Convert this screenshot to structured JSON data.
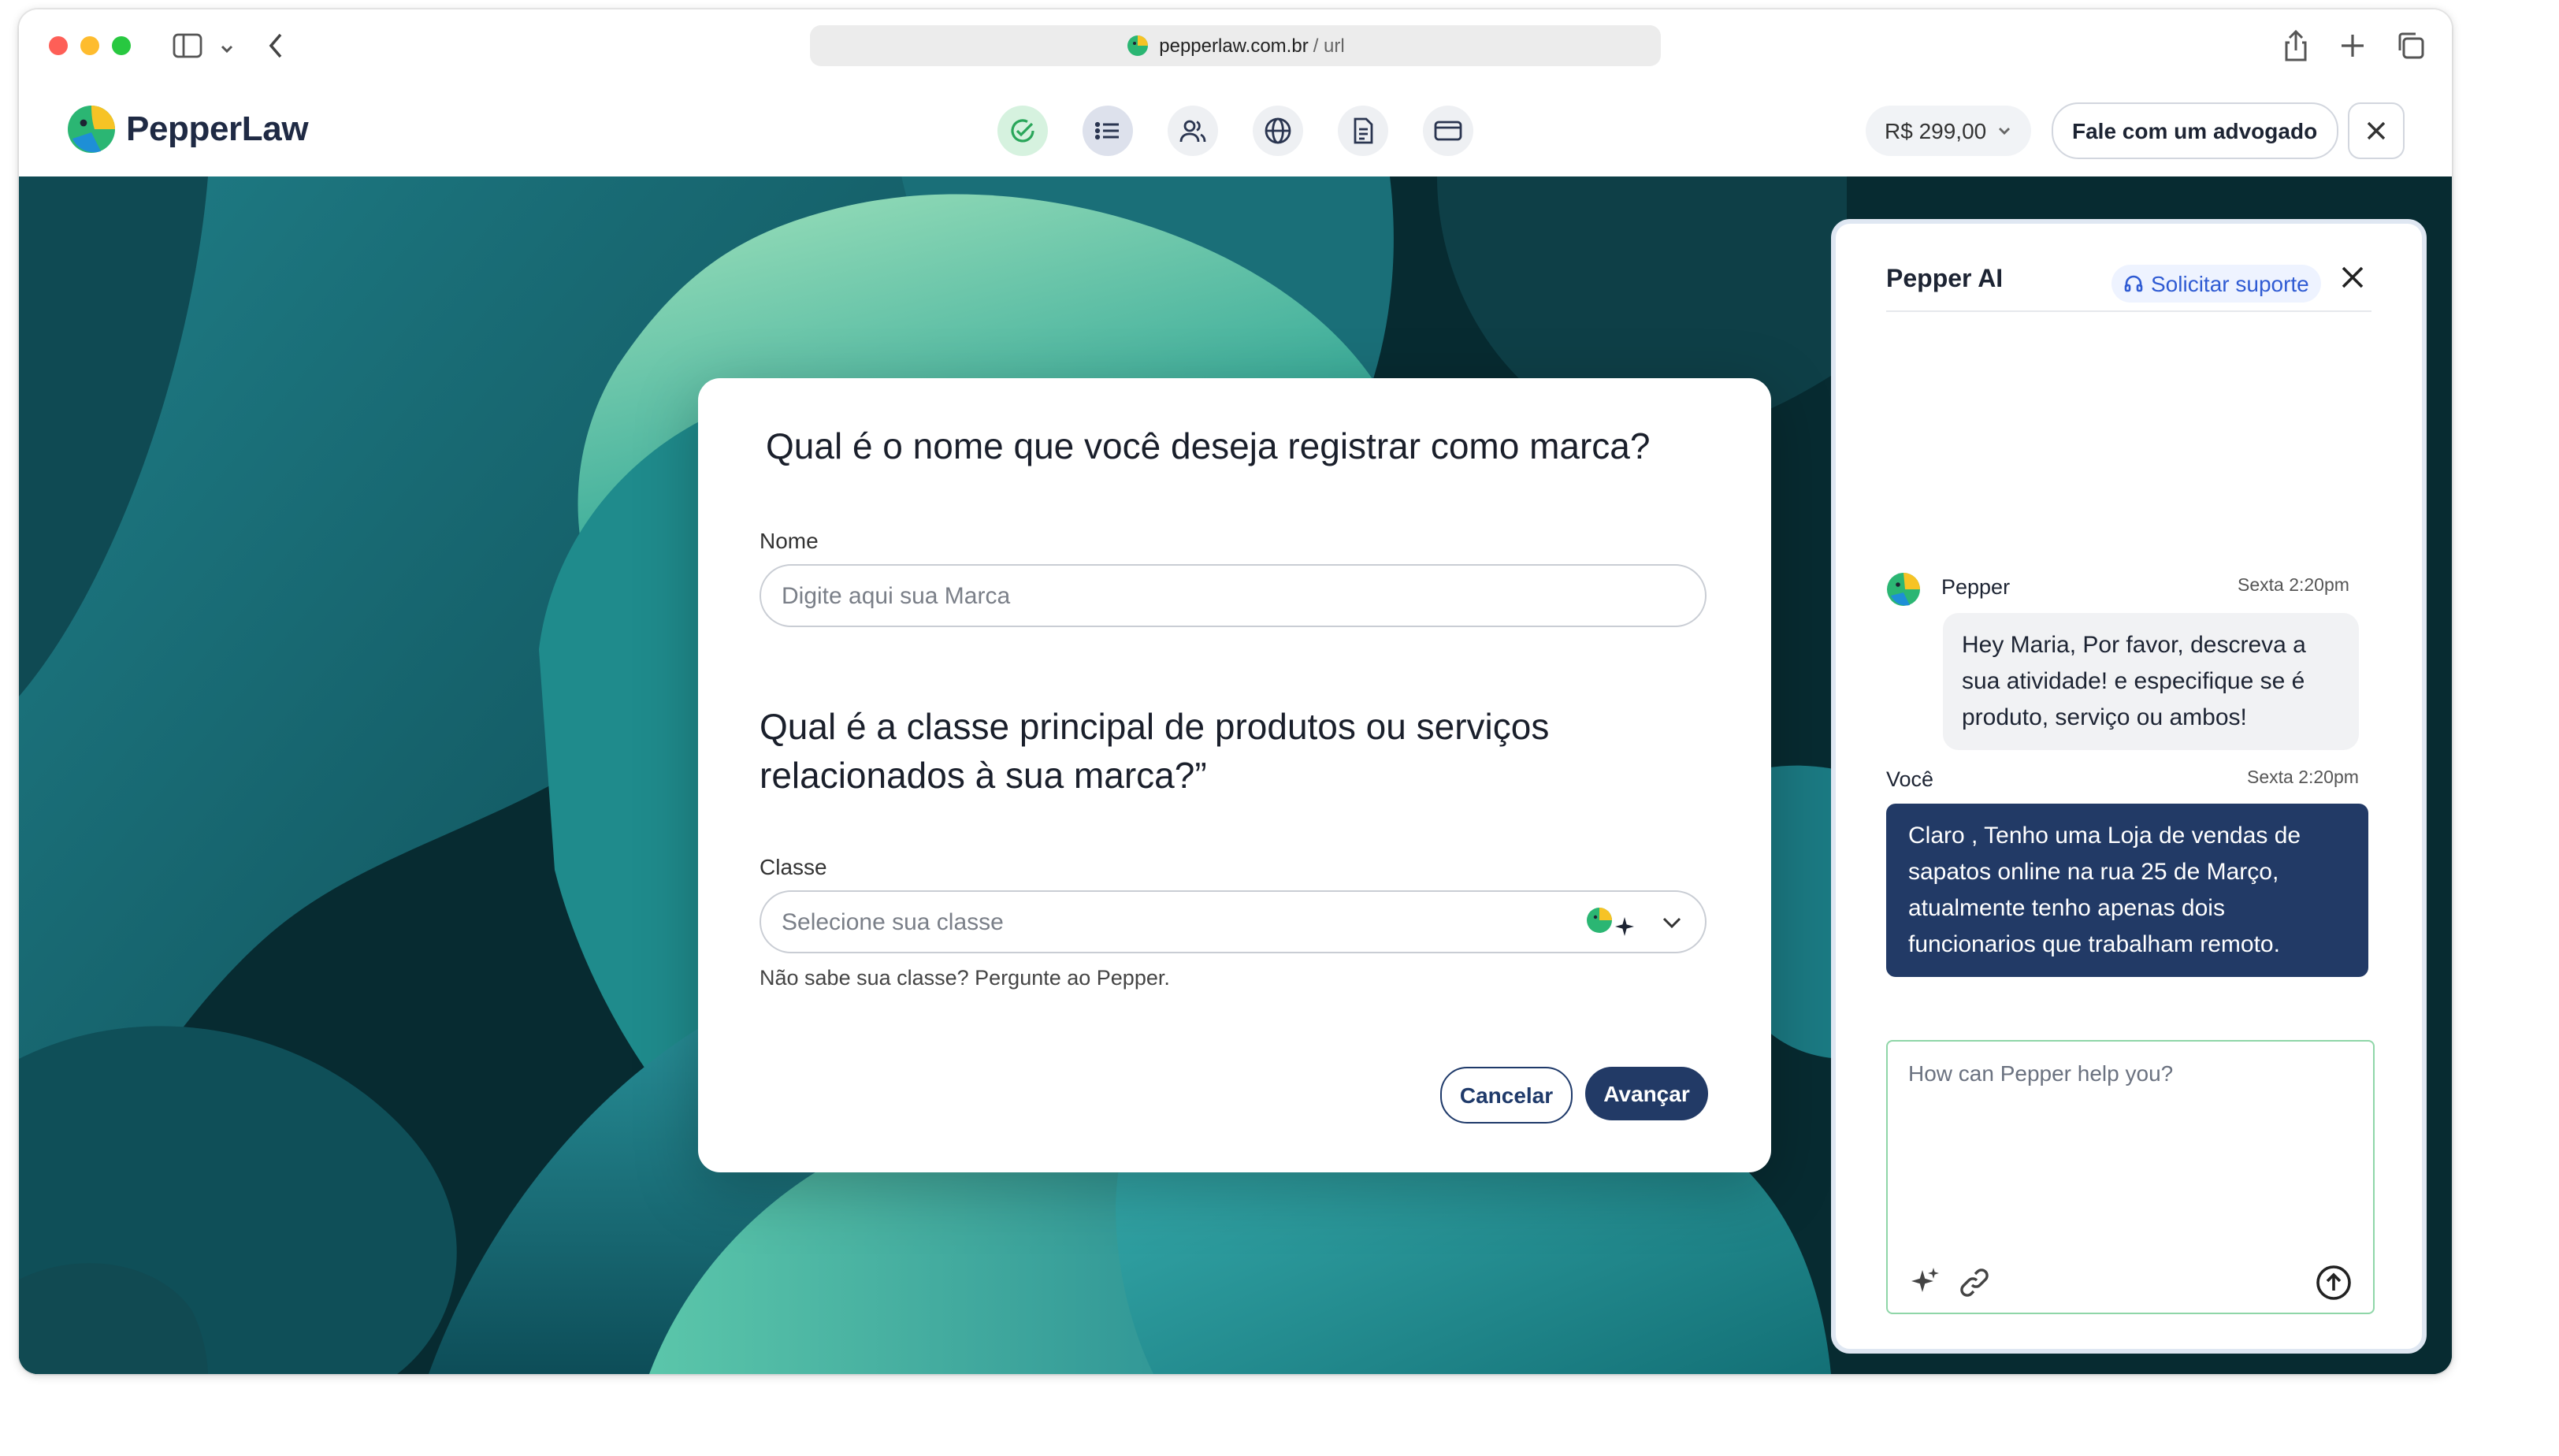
{
  "browser": {
    "url_domain": "pepperlaw.com.br",
    "url_path": "/ url"
  },
  "header": {
    "brand": "PepperLaw",
    "steps": [
      {
        "icon": "check-circle-icon",
        "state": "done"
      },
      {
        "icon": "list-icon",
        "state": "active"
      },
      {
        "icon": "users-icon",
        "state": "pending"
      },
      {
        "icon": "globe-icon",
        "state": "pending"
      },
      {
        "icon": "document-icon",
        "state": "pending"
      },
      {
        "icon": "credit-card-icon",
        "state": "pending"
      }
    ],
    "price": "R$ 299,00",
    "lawyer_button": "Fale com um advogado"
  },
  "form": {
    "question_name": "Qual é o nome que você deseja registrar como marca?",
    "name_label": "Nome",
    "name_placeholder": "Digite aqui sua Marca",
    "question_class": "Qual é a classe principal de produtos ou serviços relacionados à sua marca?”",
    "class_label": "Classe",
    "class_placeholder": "Selecione sua classe",
    "class_hint": "Não sabe sua classe? Pergunte ao Pepper.",
    "cancel_label": "Cancelar",
    "next_label": "Avançar"
  },
  "chat": {
    "title": "Pepper AI",
    "support_label": "Solicitar suporte",
    "messages": [
      {
        "author": "Pepper",
        "time": "Sexta 2:20pm",
        "text": "Hey Maria, Por favor, descreva a sua atividade! e especifique se é produto, serviço ou ambos!"
      },
      {
        "author": "Você",
        "time": "Sexta 2:20pm",
        "text": "Claro , Tenho uma Loja de vendas de sapatos online  na rua 25 de Março, atualmente tenho apenas dois funcionarios que trabalham remoto."
      }
    ],
    "composer_placeholder": "How can Pepper help you?"
  },
  "colors": {
    "brand_navy": "#223a66",
    "accent_green": "#2aa65a",
    "support_blue": "#2f5bd3"
  }
}
